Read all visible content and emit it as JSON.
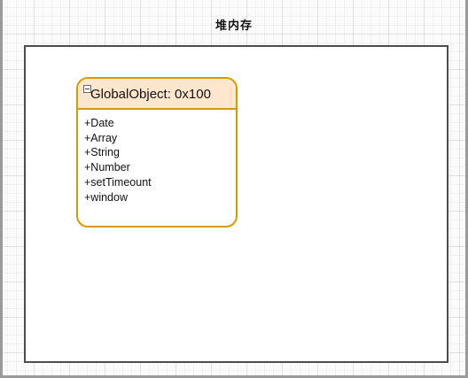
{
  "diagram": {
    "title": "堆内存",
    "class_box": {
      "name": "GlobalObject: 0x100",
      "collapse_icon": "minus-square-icon",
      "members": [
        "+Date",
        "+Array",
        "+String",
        "+Number",
        "+setTimeount",
        "+window"
      ]
    },
    "colors": {
      "class_border": "#d79b00",
      "class_header_fill": "#ffe6cc",
      "container_border": "#4d4d4d"
    }
  }
}
